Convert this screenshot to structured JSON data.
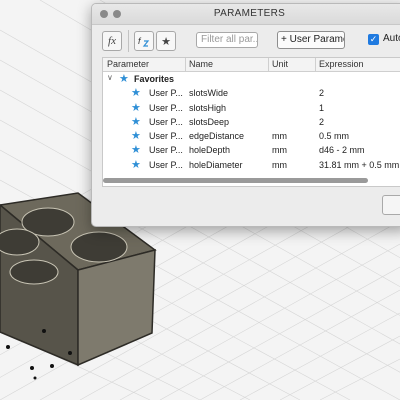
{
  "dialog": {
    "title": "PARAMETERS",
    "filter_placeholder": "Filter all par...",
    "add_button": "+ User Parameter",
    "auto_label": "Auto",
    "fx_label": "fx",
    "columns": [
      "Parameter",
      "Name",
      "Unit",
      "Expression"
    ],
    "favorites_label": "Favorites",
    "rows": [
      {
        "param": "User P...",
        "name": "slotsWide",
        "unit": "",
        "expr": "2"
      },
      {
        "param": "User P...",
        "name": "slotsHigh",
        "unit": "",
        "expr": "1"
      },
      {
        "param": "User P...",
        "name": "slotsDeep",
        "unit": "",
        "expr": "2"
      },
      {
        "param": "User P...",
        "name": "edgeDistance",
        "unit": "mm",
        "expr": "0.5 mm"
      },
      {
        "param": "User P...",
        "name": "holeDepth",
        "unit": "mm",
        "expr": "d46 - 2 mm"
      },
      {
        "param": "User P...",
        "name": "holeDiameter",
        "unit": "mm",
        "expr": "31.81 mm + 0.5 mm"
      }
    ]
  },
  "colors": {
    "accent": "#1f7ae0",
    "star": "#2f8fd6",
    "model_body": "#5e5a4f"
  }
}
